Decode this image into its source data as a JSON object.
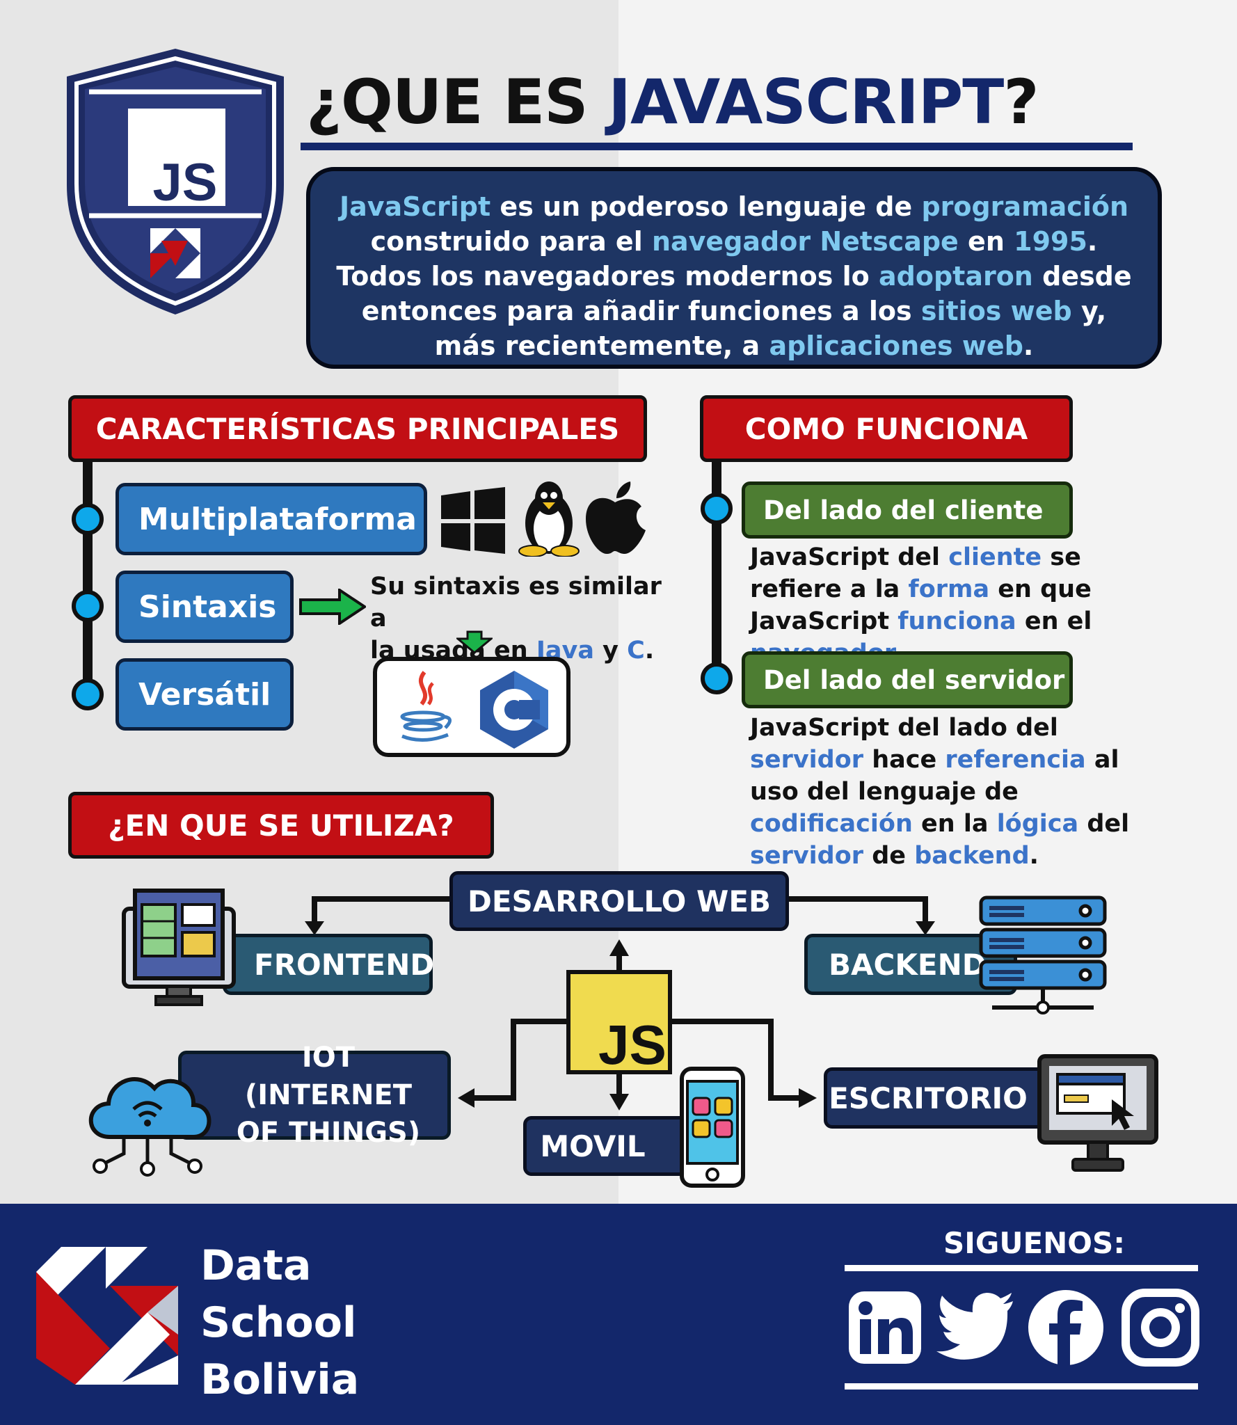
{
  "title": {
    "prefix": "¿QUE ES ",
    "highlight": "JAVASCRIPT",
    "suffix": "?"
  },
  "logo": {
    "shield_text": "JS"
  },
  "intro": {
    "p1": "JavaScript",
    "p2": " es un poderoso lenguaje de ",
    "p3": "programación",
    "p4": " construido para el ",
    "p5": "navegador Netscape",
    "p6": " en ",
    "p7": "1995",
    "p8": ". Todos los navegadores modernos lo ",
    "p9": "adoptaron",
    "p10": " desde entonces para añadir funciones a los ",
    "p11": "sitios web",
    "p12": " y, más recientemente, a ",
    "p13": "aplicaciones web",
    "p14": "."
  },
  "caracteristicas": {
    "header": "CARACTERÍSTICAS PRINCIPALES",
    "items": [
      "Multiplataforma",
      "Sintaxis",
      "Versátil"
    ],
    "sintaxis_text": {
      "s1": "Su sintaxis es similar a",
      "s2": "la usada en ",
      "s3": "Java",
      "s4": " y ",
      "s5": "C",
      "s6": "."
    },
    "c_logo_text": "C"
  },
  "como_funciona": {
    "header": "COMO FUNCIONA",
    "cliente": {
      "title": "Del lado del cliente",
      "t1": "JavaScript del ",
      "t2": "cliente",
      "t3": " se refiere a la ",
      "t4": "forma",
      "t5": " en que JavaScript ",
      "t6": "funciona",
      "t7": " en el ",
      "t8": "navegador",
      "t9": "."
    },
    "servidor": {
      "title": "Del lado del servidor",
      "t1": "JavaScript del lado del ",
      "t2": "servidor",
      "t3": " hace ",
      "t4": "referencia",
      "t5": " al uso del lenguaje de ",
      "t6": "codificación",
      "t7": " en la ",
      "t8": "lógica",
      "t9": " del ",
      "t10": "servidor",
      "t11": " de ",
      "t12": "backend",
      "t13": "."
    }
  },
  "utiliza": {
    "header": "¿EN QUE SE UTILIZA?",
    "web": "DESARROLLO WEB",
    "frontend": "FRONTEND",
    "backend": "BACKEND",
    "center": "JS",
    "iot": "IOT (INTERNET OF THINGS)",
    "movil": "MOVIL",
    "escritorio": "ESCRITORIO"
  },
  "footer": {
    "brand": [
      "Data",
      "School",
      "Bolivia"
    ],
    "siguenos": "SIGUENOS:",
    "social": [
      "linkedin-icon",
      "twitter-icon",
      "facebook-icon",
      "instagram-icon"
    ]
  },
  "colors": {
    "navy": "#13276b",
    "red": "#c20f14",
    "blue": "#2f79bf",
    "green": "#4d7d32",
    "cyan": "#0ea8ea",
    "light_blue_text": "#7fc9ef",
    "js_yellow": "#f0db4f"
  }
}
